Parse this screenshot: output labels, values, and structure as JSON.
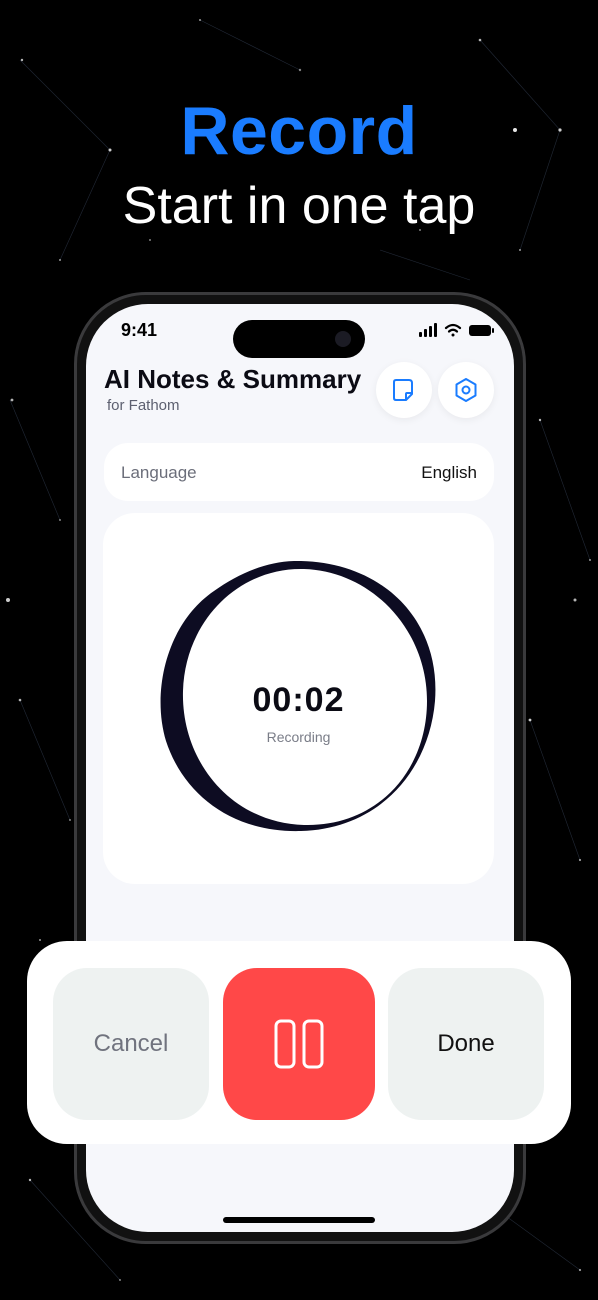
{
  "promo": {
    "headline": "Record",
    "subheadline": "Start in one tap"
  },
  "status_bar": {
    "time": "9:41"
  },
  "app": {
    "title": "AI Notes & Summary",
    "subtitle": "for Fathom",
    "header_icons": [
      "notes-icon",
      "settings-icon"
    ]
  },
  "language": {
    "label": "Language",
    "value": "English"
  },
  "recording": {
    "timer": "00:02",
    "status": "Recording"
  },
  "controls": {
    "cancel_label": "Cancel",
    "pause_icon": "pause-icon",
    "done_label": "Done"
  },
  "colors": {
    "accent": "#1a7cff",
    "pause_button": "#ff4848",
    "screen_background": "#f6f7fb",
    "blob": "#0d0c22"
  }
}
